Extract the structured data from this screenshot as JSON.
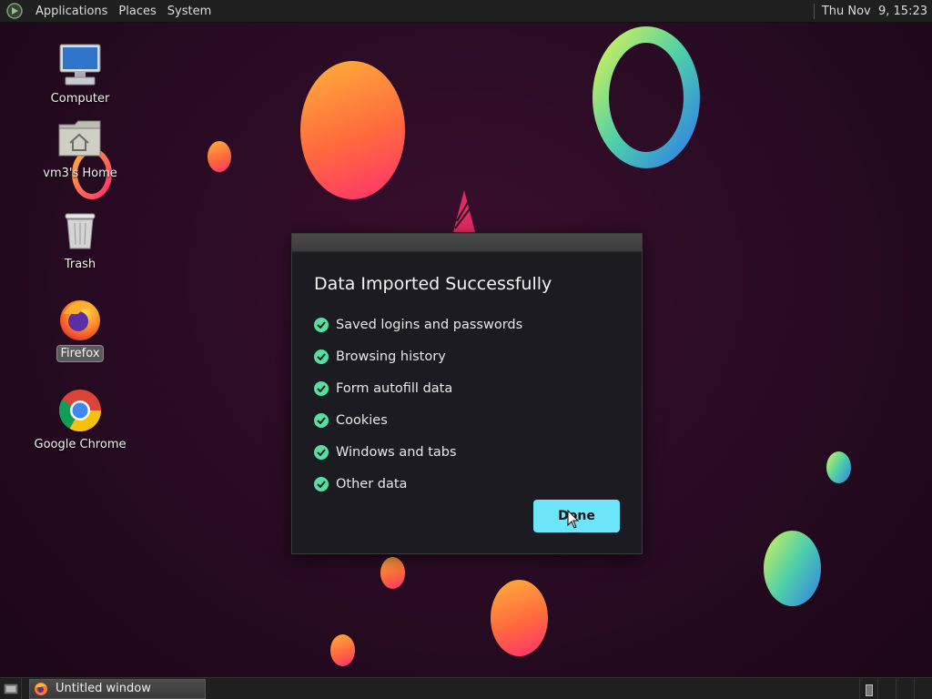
{
  "top_panel": {
    "menus": [
      "Applications",
      "Places",
      "System"
    ],
    "clock": "Thu Nov  9, 15:23"
  },
  "desktop_icons": [
    {
      "label": "Computer",
      "icon": "computer-icon"
    },
    {
      "label": "vm3's Home",
      "icon": "home-folder-icon"
    },
    {
      "label": "Trash",
      "icon": "trash-icon"
    },
    {
      "label": "Firefox",
      "icon": "firefox-icon",
      "selected": true
    },
    {
      "label": "Google Chrome",
      "icon": "chrome-icon"
    }
  ],
  "dialog": {
    "heading": "Data Imported Successfully",
    "items": [
      "Saved logins and passwords",
      "Browsing history",
      "Form autofill data",
      "Cookies",
      "Windows and tabs",
      "Other data"
    ],
    "done_label": "Done"
  },
  "taskbar": {
    "task_title": "Untitled window"
  },
  "colors": {
    "accent_button": "#6ee6fa",
    "check": "#54e0a0",
    "dialog_bg": "#1c1b22"
  }
}
